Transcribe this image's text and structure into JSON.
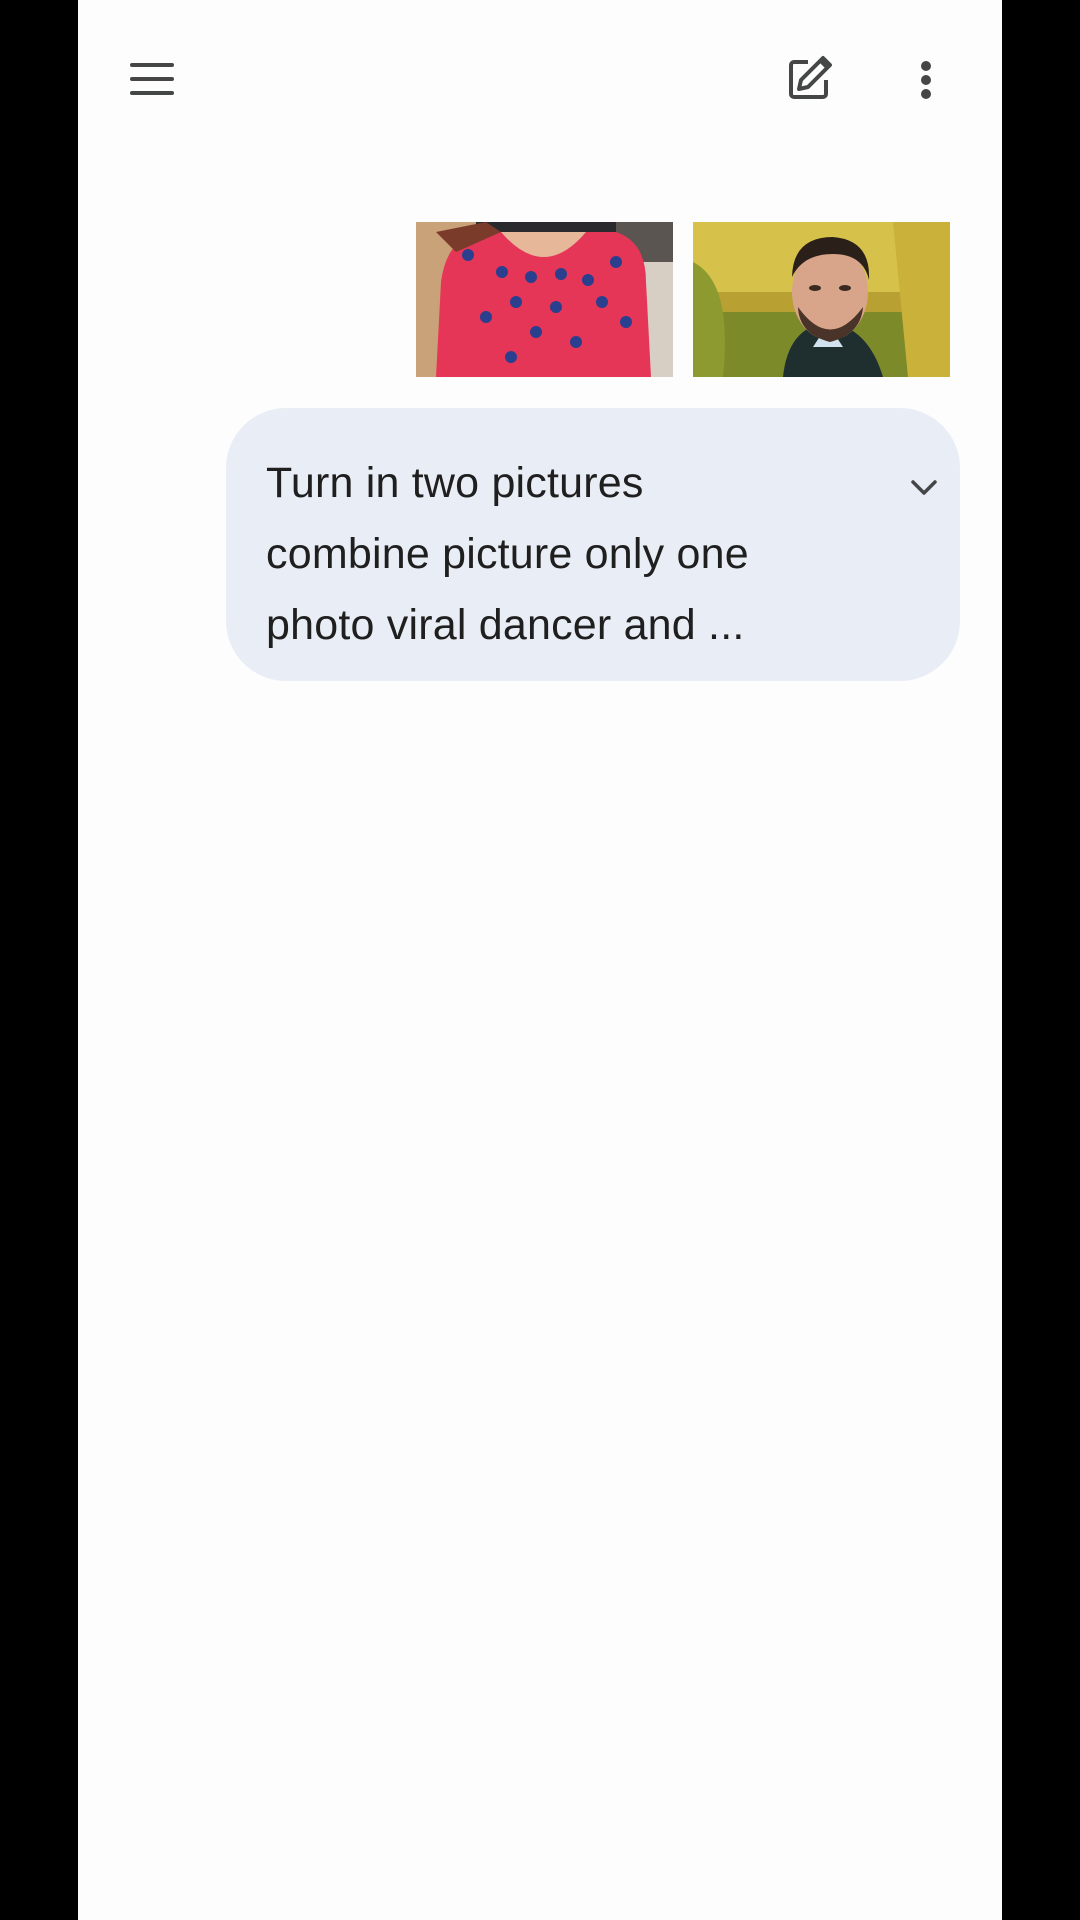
{
  "toolbar": {
    "menu_icon": "hamburger-menu-icon",
    "new_chat_icon": "edit-pencil-icon",
    "more_icon": "more-vert-icon",
    "icon_color": "#444746"
  },
  "message": {
    "attachments": [
      {
        "icon": "image-thumbnail-dancer-red-top"
      },
      {
        "icon": "image-thumbnail-man-portrait"
      }
    ],
    "lines": [
      "Turn in two pictures",
      "combine picture only one",
      "photo viral dancer and ..."
    ],
    "expand_icon": "chevron-down-icon",
    "bubble_color": "#e9edf5"
  }
}
